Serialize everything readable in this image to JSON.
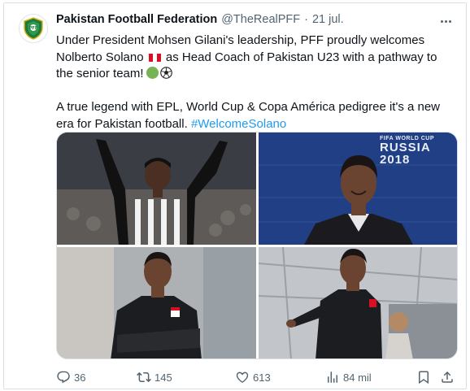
{
  "tweet": {
    "author_name": "Pakistan Football Federation",
    "handle": "@TheRealPFF",
    "separator": "·",
    "date": "21 jul.",
    "avatar_label": "PFF",
    "text_line1_a": "Under President Mohsen Gilani's leadership, PFF proudly welcomes Nolberto Solano",
    "text_line1_b": "as Head Coach of Pakistan U23 with a pathway to the senior team!",
    "text_para2": "A true legend with EPL, World Cup & Copa América pedigree it's a new era for Pakistan football.",
    "hashtag": "#WelcomeSolano"
  },
  "media": {
    "wc_logo_top": "FIFA WORLD CUP",
    "wc_logo_main": "RUSSIA",
    "wc_logo_year": "2018"
  },
  "stats": {
    "replies": "36",
    "retweets": "145",
    "likes": "613",
    "views": "84 mil"
  },
  "colors": {
    "hashtag": "#1d9bf0",
    "muted": "#536471",
    "peru_red": "#d91023"
  },
  "icons": [
    "pff-logo-icon",
    "more-icon",
    "peru-flag-icon",
    "green-circle-icon",
    "soccer-ball-icon",
    "reply-icon",
    "retweet-icon",
    "like-icon",
    "views-icon",
    "bookmark-icon",
    "share-icon"
  ]
}
